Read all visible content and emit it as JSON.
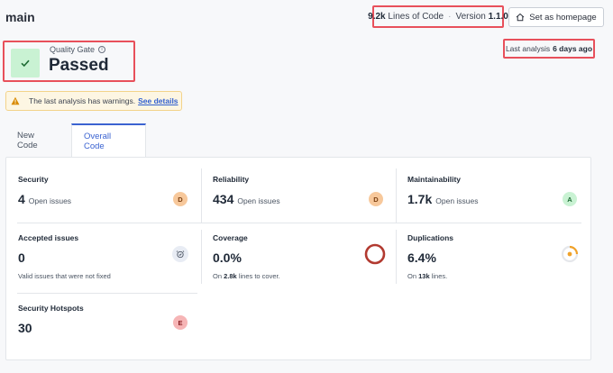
{
  "header": {
    "branch": "main",
    "loc_value": "9.2k",
    "loc_label": "Lines of Code",
    "version_label": "Version",
    "version_value": "1.1.0",
    "homepage_button": "Set as homepage"
  },
  "quality_gate": {
    "label": "Quality Gate",
    "status": "Passed"
  },
  "last_analysis": {
    "label": "Last analysis",
    "value": "6 days ago"
  },
  "warning": {
    "text": "The last analysis has warnings.",
    "link": "See details"
  },
  "tabs": [
    {
      "label": "New Code"
    },
    {
      "label": "Overall Code"
    }
  ],
  "metrics": {
    "security": {
      "title": "Security",
      "value": "4",
      "unit": "Open issues",
      "rating": "D"
    },
    "reliability": {
      "title": "Reliability",
      "value": "434",
      "unit": "Open issues",
      "rating": "D"
    },
    "maintainability": {
      "title": "Maintainability",
      "value": "1.7k",
      "unit": "Open issues",
      "rating": "A"
    },
    "accepted": {
      "title": "Accepted issues",
      "value": "0",
      "sub": "Valid issues that were not fixed"
    },
    "coverage": {
      "title": "Coverage",
      "value": "0.0%",
      "sub_pre": "On",
      "sub_num": "2.8k",
      "sub_post": "lines to cover.",
      "percent": 0
    },
    "duplications": {
      "title": "Duplications",
      "value": "6.4%",
      "sub_pre": "On",
      "sub_num": "13k",
      "sub_post": "lines.",
      "percent": 6.4
    },
    "hotspots": {
      "title": "Security Hotspots",
      "value": "30",
      "rating": "E"
    }
  },
  "colors": {
    "accent": "#3b63d1",
    "highlight_border": "#e8505b",
    "passed_bg": "#c9f2d3",
    "coverage_ring": "#b23a30",
    "duplication_arc": "#f0a22a"
  }
}
